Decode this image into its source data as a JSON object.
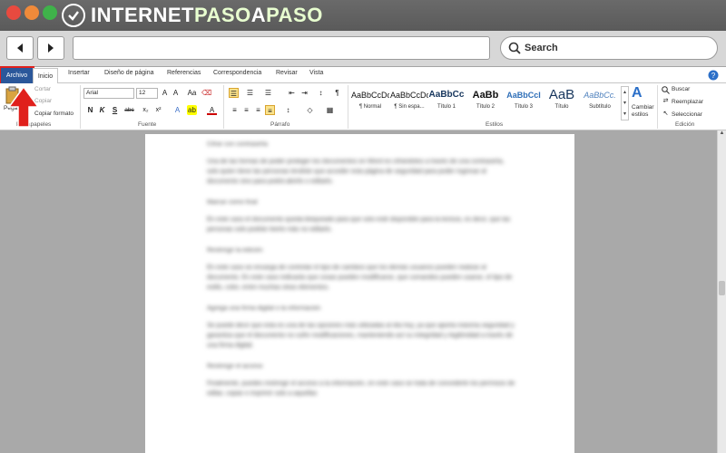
{
  "site": {
    "brand_a": "INTERNET",
    "brand_b": "PASO",
    "brand_c": "A",
    "brand_d": "PASO"
  },
  "browser": {
    "search_label": "Search",
    "back_icon": "back-arrow-icon",
    "forward_icon": "forward-arrow-icon"
  },
  "tabs": {
    "archivo": "Archivo",
    "inicio": "Inicio",
    "insertar": "Insertar",
    "diseno": "Diseño de página",
    "referencias": "Referencias",
    "correspondencia": "Correspondencia",
    "revisar": "Revisar",
    "vista": "Vista"
  },
  "clipboard": {
    "pegar": "Pegar",
    "cortar": "Cortar",
    "copiar": "Copiar",
    "copiar_formato": "Copiar formato",
    "label": "Portapapeles"
  },
  "font": {
    "name": "Arial",
    "size": "12",
    "label": "Fuente",
    "bold": "N",
    "italic": "K",
    "underline": "S",
    "strike": "abc",
    "sub": "x₂",
    "sup": "x²"
  },
  "paragraph": {
    "label": "Párrafo"
  },
  "styles": {
    "label": "Estilos",
    "items": [
      {
        "preview": "AaBbCcDc",
        "name": "¶ Normal"
      },
      {
        "preview": "AaBbCcDc",
        "name": "¶ Sin espa..."
      },
      {
        "preview": "AaBbCc",
        "name": "Título 1"
      },
      {
        "preview": "AaBb",
        "name": "Título 2"
      },
      {
        "preview": "AaBbCcI",
        "name": "Título 3"
      },
      {
        "preview": "AaB",
        "name": "Título"
      },
      {
        "preview": "AaBbCc.",
        "name": "Subtítulo"
      }
    ],
    "change": "Cambiar estilos"
  },
  "editing": {
    "label": "Edición",
    "buscar": "Buscar",
    "reemplazar": "Reemplazar",
    "seleccionar": "Seleccionar"
  },
  "document": {
    "p1_head": "Cifrar con contraseña",
    "p1": "Una de las formas de poder proteger los documentos en Word es cifrándolos a través de una contraseña, solo quien tiene las personas tendrán que acceder esta página de seguridad para poder ingresar al documento sino para podrá abrirlo o editarlo.",
    "h2": "Marcar como final",
    "p2": "En este caso el documento queda bloqueado para que solo esté disponible para la lectura, es decir, que las personas solo podrán leerlo más no editarlo.",
    "h3": "Restringir la edición",
    "p3": "En este caso se encarga de controlar el tipo de cambios que los demás usuarios pueden realizar al documento. En este caso indicarás que cosas pueden modificarse, que comandos pueden usarse, el tipo de estilo, color, entre muchas otras elementos.",
    "h4": "Agrega una firma digital o la información",
    "p4": "Se puede decir que esta es una de las opciones más utilizadas al día hoy, ya que aporta máxima seguridad y garantiza que el documento no sufre modificaciones, manteniendo así su integridad y legitimidad a través de una firma digital.",
    "h5": "Restringir el acceso",
    "p5": "Finalmente, puedes restringir el acceso a la información, en este caso se trata de concederle los permisos de editar, copiar e imprimir solo a aquellas"
  }
}
